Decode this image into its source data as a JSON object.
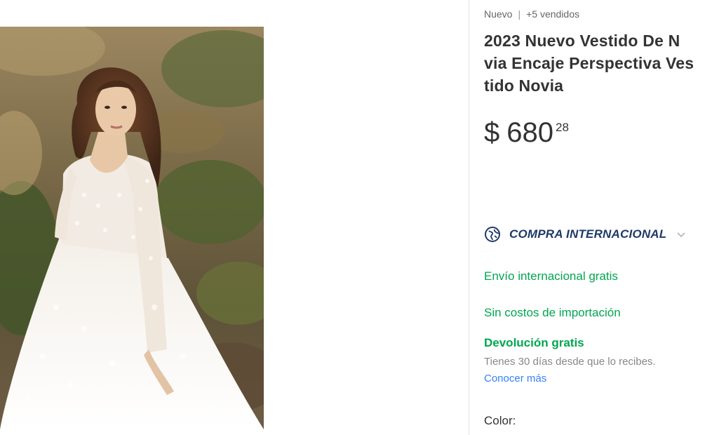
{
  "gallery": {
    "image_icon": "wedding-dress-photo"
  },
  "product": {
    "condition": "Nuevo",
    "separator": "|",
    "sold": "+5 vendidos",
    "title_lines": [
      "2023 Nuevo Vestido De N",
      "via Encaje Perspectiva Ves",
      "tido Novia"
    ],
    "price": {
      "currency": "$",
      "amount": "680",
      "cents": "28"
    },
    "international": {
      "icon": "globe-icon",
      "label": "COMPRA INTERNACIONAL",
      "chevron_icon": "chevron-down-icon"
    },
    "shipping": "Envío internacional gratis",
    "import_costs": "Sin costos de importación",
    "returns": {
      "title": "Devolución gratis",
      "detail": "Tienes 30 días desde que lo recibes.",
      "link": "Conocer más"
    },
    "color_label": "Color:"
  },
  "colors": {
    "green": "#00a650",
    "link": "#3483fa",
    "international": "#1f3a68",
    "text": "#333333",
    "muted": "#888888"
  }
}
